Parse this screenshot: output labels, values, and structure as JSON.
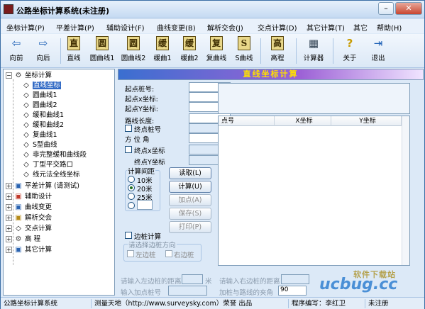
{
  "window": {
    "title": "公路坐标计算系统(未注册)"
  },
  "menu": [
    "坐标计算(P)",
    "平差计算(P)",
    "辅助设计(F)",
    "曲线变更(B)",
    "解析交会(J)",
    "交点计算(D)",
    "其它计算(T)",
    "其它",
    "帮助(H)"
  ],
  "toolbar": [
    {
      "icon": "arrow-left-icon",
      "label": "向前"
    },
    {
      "icon": "arrow-right-icon",
      "label": "向后"
    },
    {
      "icon": "book-icon",
      "glyph": "直",
      "label": "直线"
    },
    {
      "icon": "book-icon",
      "glyph": "圆",
      "label": "圆曲线1"
    },
    {
      "icon": "book-icon",
      "glyph": "圆",
      "label": "圆曲线2"
    },
    {
      "icon": "book-icon",
      "glyph": "缓",
      "label": "缓曲1"
    },
    {
      "icon": "book-icon",
      "glyph": "缓",
      "label": "缓曲2"
    },
    {
      "icon": "book-icon",
      "glyph": "复",
      "label": "复曲线"
    },
    {
      "icon": "book-icon",
      "glyph": "S",
      "label": "S曲线"
    },
    {
      "icon": "book-icon",
      "glyph": "高",
      "label": "高程"
    },
    {
      "icon": "calculator-icon",
      "label": "计算器"
    },
    {
      "icon": "help-icon",
      "label": "关于"
    },
    {
      "icon": "exit-icon",
      "label": "退出"
    }
  ],
  "tree": {
    "root": "坐标计算",
    "children": [
      "直线坐标",
      "圆曲线1",
      "圆曲线2",
      "缓和曲线1",
      "缓和曲线2",
      "复曲线1",
      "S型曲线",
      "非完整缓和曲线段",
      "丁型平交路口",
      "线元法全线坐标"
    ],
    "others": [
      "平差计算 (请测试)",
      "辅助设计",
      "曲线变更",
      "解析交会",
      "交点计算",
      "高 程",
      "其它计算"
    ]
  },
  "panel": {
    "banner": "直线坐标计算",
    "start_station": "起点桩号:",
    "start_x": "起点x坐标:",
    "start_y": "起点Y坐标:",
    "road_length": "路线长度:",
    "end_station": "终点桩号",
    "azimuth": "方 位 角",
    "end_x": "终点x坐标",
    "end_y": "终点Y坐标",
    "interval_group": "计算间距",
    "interval_options": [
      "10米",
      "20米",
      "25米"
    ],
    "interval_selected": "20米",
    "buttons": {
      "read": "读取(L)",
      "calc": "计算(U)",
      "add": "加点(A)",
      "save": "保存(S)",
      "print": "打印(P)"
    },
    "edge_station": "边桩计算",
    "edge_dir_group": "请选择边桩方向",
    "left_edge": "左边桩",
    "right_edge": "右边桩",
    "left_dist": "请输入左边桩的距离",
    "left_unit": "米",
    "add_station": "输入加点桩号",
    "right_dist": "请输入右边桩的距离",
    "angle": "加桩与路线的夹角",
    "angle_value": "90"
  },
  "grid": {
    "columns": [
      "点号",
      "X坐标",
      "Y坐标"
    ]
  },
  "status": {
    "app": "公路坐标计算系统",
    "credit": "测量天地（http://www.surveysky.com）荣誉 出品",
    "designer": "程序编写：李红卫",
    "reg": "未注册"
  },
  "watermark": {
    "line1": "软件下载站",
    "line2": "ucbug.cc"
  },
  "colors": {
    "banner_text": "#ffe000",
    "selection": "#316ac5"
  }
}
